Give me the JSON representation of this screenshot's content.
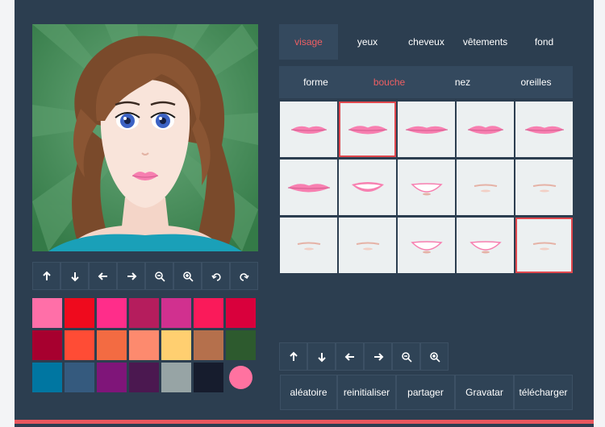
{
  "main_tabs": [
    {
      "label": "visage",
      "active": true
    },
    {
      "label": "yeux",
      "active": false
    },
    {
      "label": "cheveux",
      "active": false
    },
    {
      "label": "vêtements",
      "active": false
    },
    {
      "label": "fond",
      "active": false
    }
  ],
  "sub_tabs": [
    {
      "label": "forme",
      "active": false
    },
    {
      "label": "bouche",
      "active": true
    },
    {
      "label": "nez",
      "active": false
    },
    {
      "label": "oreilles",
      "active": false
    }
  ],
  "preview_toolbar": [
    "arrow-up-icon",
    "arrow-down-icon",
    "arrow-left-icon",
    "arrow-right-icon",
    "zoom-out-icon",
    "zoom-in-icon",
    "undo-icon",
    "redo-icon"
  ],
  "grid_toolbar": [
    "arrow-up-icon",
    "arrow-down-icon",
    "arrow-left-icon",
    "arrow-right-icon",
    "zoom-out-icon",
    "zoom-in-icon"
  ],
  "palette": [
    [
      "#ff6fa8",
      "#ef0a1d",
      "#ff2d8a",
      "#b51d5d",
      "#d1308f",
      "#fa1a5a",
      "#d9003c"
    ],
    [
      "#a7002f",
      "#ff4c35",
      "#f36b42",
      "#fd8a6e",
      "#ffcf70",
      "#b5704c",
      "#2d5a2e"
    ],
    [
      "#0076a1",
      "#355a7e",
      "#7f1579",
      "#4b1850",
      "#97a4a5",
      "#161c2d",
      "#ff72a0"
    ]
  ],
  "selected_color": "#ff72a0",
  "mouth_options": {
    "selected_index": 1,
    "selected_color_index": 14,
    "items": [
      "lips-1",
      "lips-2",
      "lips-3",
      "lips-4",
      "lips-5",
      "lips-6",
      "lips-smile-7",
      "smile-8",
      "line-9",
      "line-10",
      "line-11",
      "line-12",
      "smile-13",
      "smile-14",
      "line-15"
    ]
  },
  "actions": [
    {
      "label": "aléatoire"
    },
    {
      "label": "reinitialiser"
    },
    {
      "label": "partager"
    },
    {
      "label": "Gravatar"
    },
    {
      "label": "télécharger"
    }
  ],
  "colors": {
    "accent": "#e8585e",
    "panel": "#2c3e50",
    "tab_bg": "#34495e",
    "cell_bg": "#ecf0f1"
  }
}
